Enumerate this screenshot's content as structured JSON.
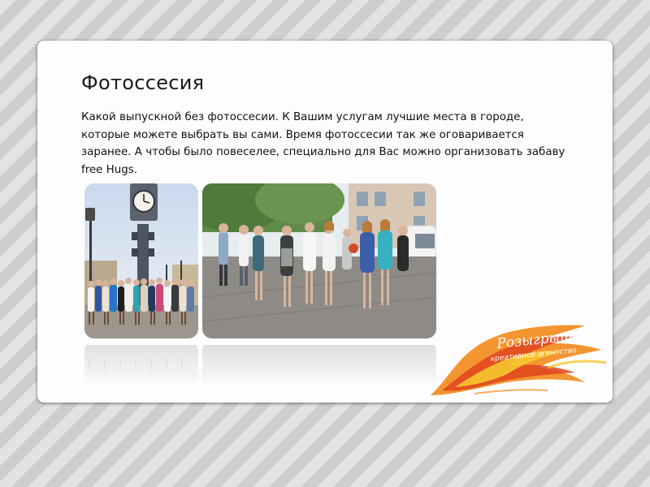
{
  "slide": {
    "title": "Фотоссесия",
    "description": "Какой выпускной без фотоссесии. К Вашим услугам лучшие места в городе, которые можете выбрать вы сами. Время фотоссесии так же оговаривается заранее. А чтобы было повеселее, специально для Вас можно организовать забаву free Hugs."
  },
  "logo": {
    "brand": "Розыгрыш",
    "tagline": "креативное агентство"
  },
  "colors": {
    "background_stripe_light": "#e3e3e3",
    "background_stripe_dark": "#cecece",
    "card": "#fdfdfd",
    "text": "#111111",
    "logo_orange": "#f28a1a",
    "logo_red": "#e0441e",
    "logo_yellow": "#f7c531"
  },
  "images": [
    {
      "name": "group-photo-clock-tower",
      "depicts": "graduates posing in front of a street clock tower"
    },
    {
      "name": "group-photo-street-walk",
      "depicts": "graduates walking on a city street"
    }
  ]
}
